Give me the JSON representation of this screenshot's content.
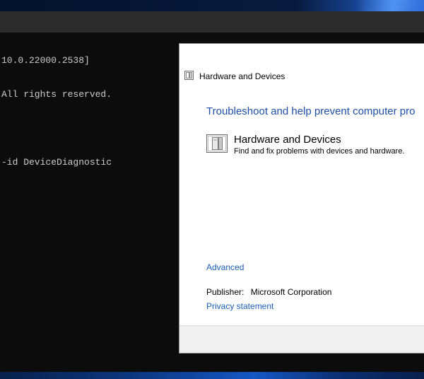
{
  "console": {
    "lines": [
      "10.0.22000.2538]",
      "All rights reserved.",
      "",
      "-id DeviceDiagnostic"
    ]
  },
  "dialog": {
    "title": "Hardware and Devices",
    "heading": "Troubleshoot and help prevent computer pro",
    "item": {
      "name": "Hardware and Devices",
      "description": "Find and fix problems with devices and hardware."
    },
    "advanced_link": "Advanced",
    "publisher_label": "Publisher:",
    "publisher_value": "Microsoft Corporation",
    "privacy_link": "Privacy statement"
  },
  "colors": {
    "link": "#1a5fb4",
    "heading": "#1f4fa8",
    "console_bg": "#0c0c0c",
    "console_text": "#cccccc"
  },
  "icons": {
    "dialog_title": "hardware-device-icon",
    "item": "hardware-device-icon"
  }
}
